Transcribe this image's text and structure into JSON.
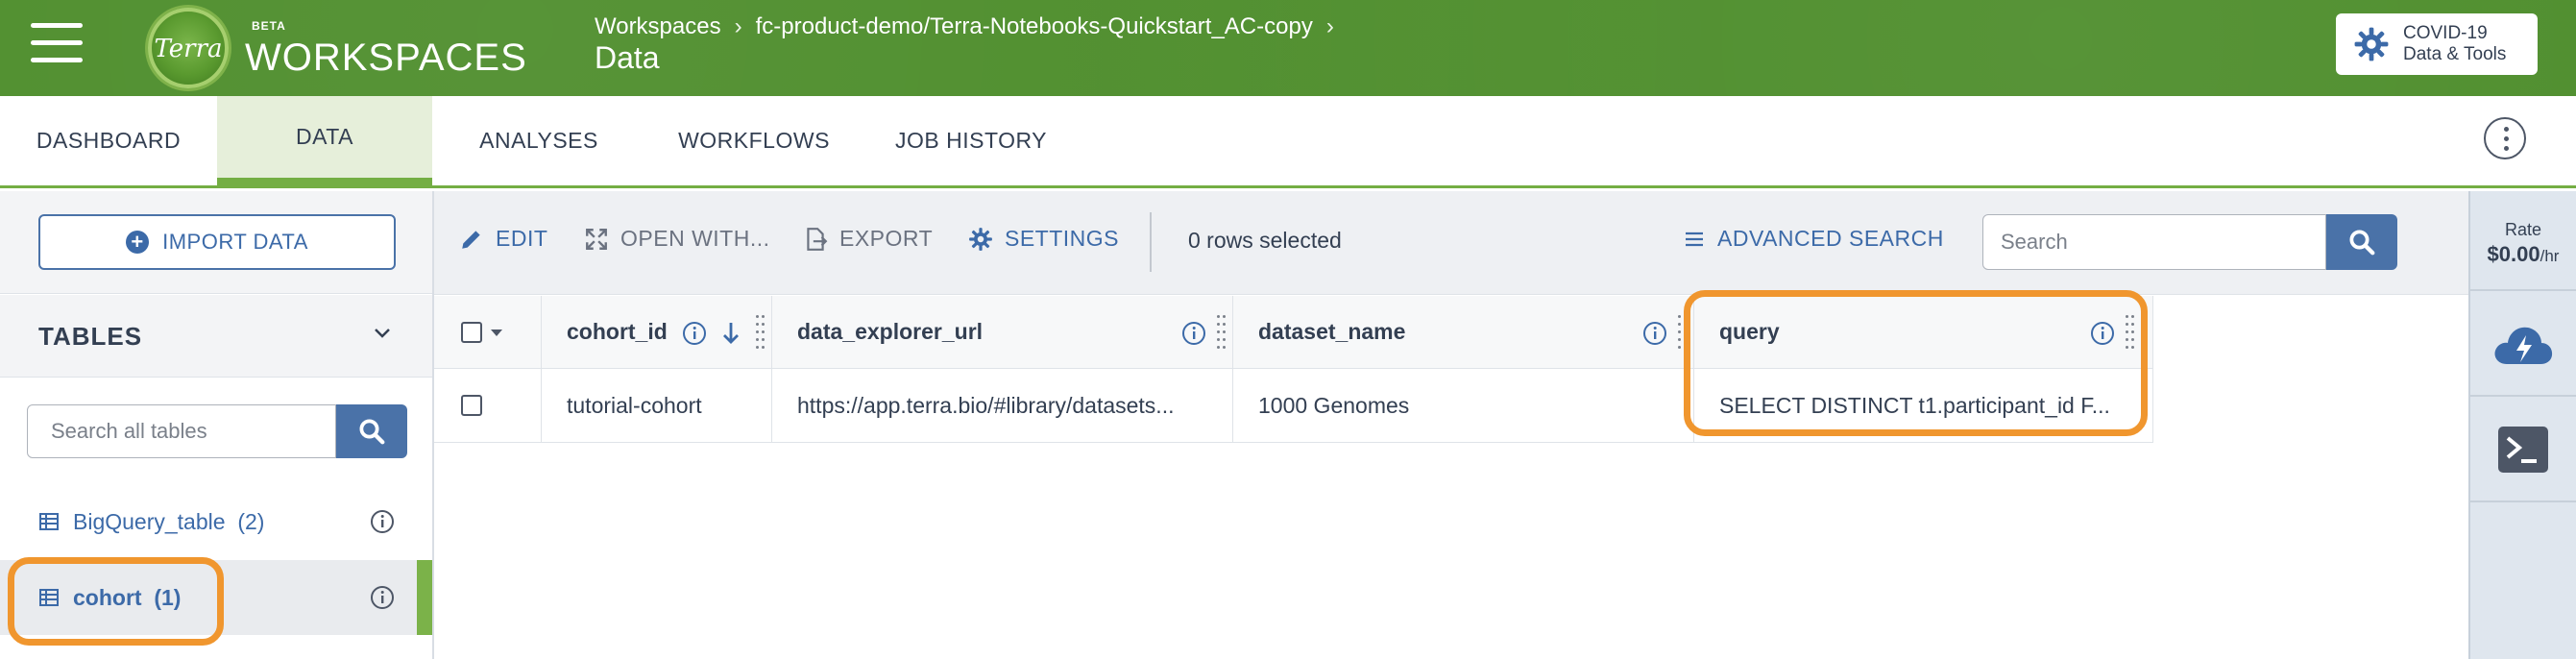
{
  "header": {
    "logo_text": "Terra",
    "beta": "BETA",
    "app_title": "WORKSPACES",
    "breadcrumb": [
      "Workspaces",
      "fc-product-demo/Terra-Notebooks-Quickstart_AC-copy"
    ],
    "breadcrumb_sep": "›",
    "page_title": "Data",
    "covid_button": {
      "line1": "COVID-19",
      "line2": "Data & Tools"
    }
  },
  "tabs": [
    {
      "label": "DASHBOARD",
      "active": false
    },
    {
      "label": "DATA",
      "active": true
    },
    {
      "label": "ANALYSES",
      "active": false
    },
    {
      "label": "WORKFLOWS",
      "active": false
    },
    {
      "label": "JOB HISTORY",
      "active": false
    }
  ],
  "sidebar": {
    "import_label": "IMPORT DATA",
    "tables_label": "TABLES",
    "search_placeholder": "Search all tables",
    "tables": [
      {
        "name": "BigQuery_table",
        "count": "(2)",
        "selected": false
      },
      {
        "name": "cohort",
        "count": "(1)",
        "selected": true
      }
    ]
  },
  "toolbar": {
    "edit": "EDIT",
    "open_with": "OPEN WITH...",
    "export": "EXPORT",
    "settings": "SETTINGS",
    "rows_selected": "0 rows selected",
    "advanced_search": "ADVANCED SEARCH",
    "search_placeholder": "Search"
  },
  "grid": {
    "columns": [
      "cohort_id",
      "data_explorer_url",
      "dataset_name",
      "query"
    ],
    "rows": [
      [
        "tutorial-cohort",
        "https://app.terra.bio/#library/datasets...",
        "1000 Genomes",
        "SELECT DISTINCT t1.participant_id F..."
      ]
    ]
  },
  "rail": {
    "rate_label": "Rate",
    "rate_value": "$0.00",
    "rate_unit": "/hr"
  },
  "colors": {
    "header_green": "#4d8d2b",
    "accent_blue": "#3c6aa8",
    "highlight_orange": "#f0962e",
    "tab_active": "#74ae43"
  }
}
